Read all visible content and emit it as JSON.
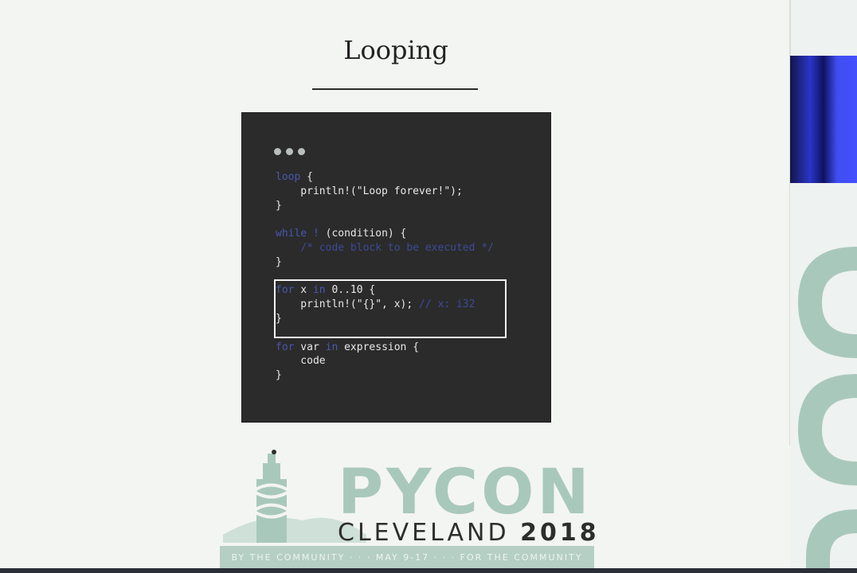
{
  "slide": {
    "title": "Looping"
  },
  "code": {
    "lines": [
      [
        {
          "t": "loop",
          "c": "kw"
        },
        {
          "t": " {"
        }
      ],
      [
        {
          "t": "    println!(\"Loop forever!\");"
        }
      ],
      [
        {
          "t": "}"
        }
      ],
      [
        {
          "t": ""
        }
      ],
      [
        {
          "t": "while",
          "c": "kw"
        },
        {
          "t": " "
        },
        {
          "t": "!",
          "c": "kw"
        },
        {
          "t": " (condition) {"
        }
      ],
      [
        {
          "t": "    "
        },
        {
          "t": "/* code block to be executed */",
          "c": "cm"
        }
      ],
      [
        {
          "t": "}"
        }
      ],
      [
        {
          "t": ""
        }
      ],
      [
        {
          "t": "for",
          "c": "kw"
        },
        {
          "t": " x "
        },
        {
          "t": "in",
          "c": "kw"
        },
        {
          "t": " 0..10 {"
        }
      ],
      [
        {
          "t": "    println!(\"{}\", x); "
        },
        {
          "t": "// x: i32",
          "c": "cm"
        }
      ],
      [
        {
          "t": "}"
        }
      ],
      [
        {
          "t": ""
        }
      ],
      [
        {
          "t": "for",
          "c": "kw"
        },
        {
          "t": " var "
        },
        {
          "t": "in",
          "c": "kw"
        },
        {
          "t": " expression {"
        }
      ],
      [
        {
          "t": "    code"
        }
      ],
      [
        {
          "t": "}"
        }
      ]
    ]
  },
  "logo": {
    "pycon": "PYCON",
    "city": "CLEVELAND",
    "year": "2018",
    "banner": "BY THE COMMUNITY · · · MAY 9-17 · · · FOR THE COMMUNITY"
  },
  "colors": {
    "accent_green": "#a9c8bc",
    "code_bg": "#2b2b2b",
    "keyword": "#4a57b0"
  }
}
